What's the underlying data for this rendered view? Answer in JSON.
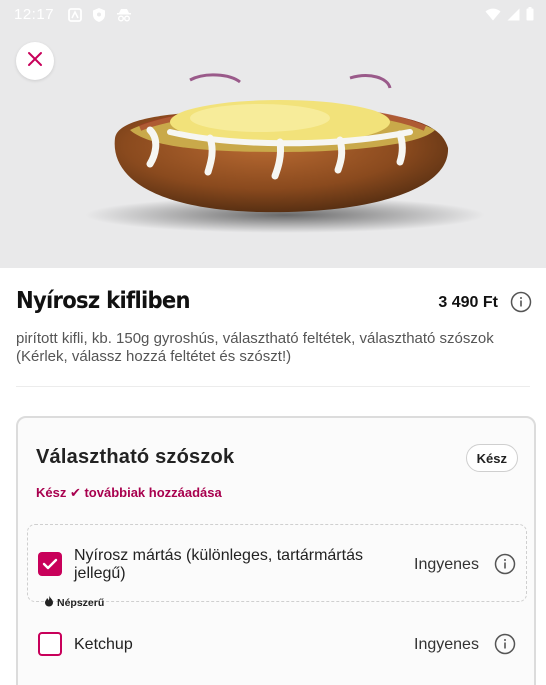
{
  "status_bar": {
    "time": "12:17",
    "left_icons": [
      "app-icon",
      "shield-icon",
      "incognito-icon"
    ],
    "right_icons": [
      "wifi-icon",
      "signal-icon",
      "battery-icon"
    ]
  },
  "product": {
    "name": "Nyírosz kifliben",
    "price": "3 490 Ft",
    "description": "pirított kifli, kb. 150g gyroshús, választható feltétek, választható szószok (Kérlek, válassz hozzá feltétet és szószt!)"
  },
  "options_card": {
    "title": "Választható szószok",
    "done_label": "Kész",
    "subtitle": "Kész ✔ továbbiak hozzáadása",
    "items": [
      {
        "label": "Nyírosz mártás (különleges, tartármártás jellegű)",
        "price": "Ingyenes",
        "checked": true,
        "badge": "Népszerű"
      },
      {
        "label": "Ketchup",
        "price": "Ingyenes",
        "checked": false
      }
    ]
  },
  "colors": {
    "accent": "#c8005a",
    "subtitle": "#a8004e",
    "hero_bg": "#e9e9ea"
  }
}
